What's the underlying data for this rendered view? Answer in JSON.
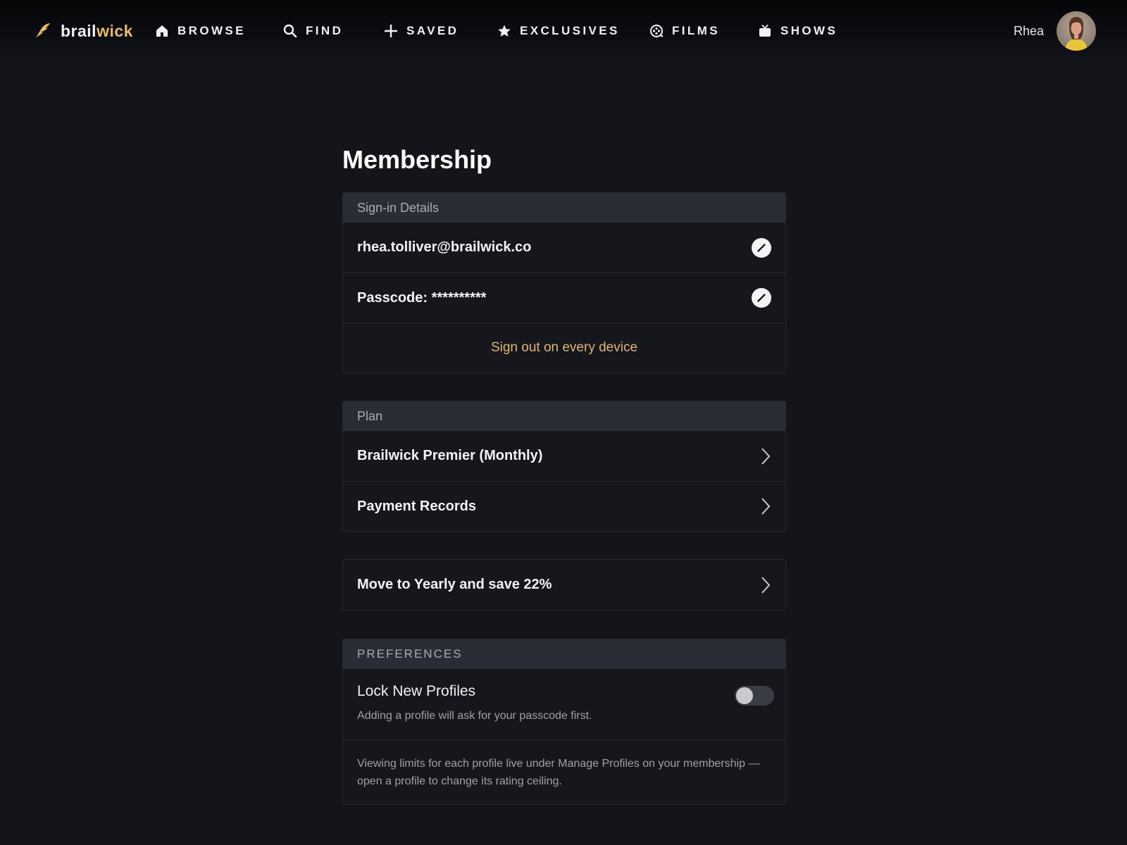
{
  "brand": {
    "name_part1": "brail",
    "name_part2": "wick",
    "accent": "#e8b96a"
  },
  "nav": [
    {
      "label": "BROWSE",
      "icon": "home-icon"
    },
    {
      "label": "FIND",
      "icon": "search-icon"
    },
    {
      "label": "SAVED",
      "icon": "plus-icon"
    },
    {
      "label": "EXCLUSIVES",
      "icon": "star-icon"
    },
    {
      "label": "FILMS",
      "icon": "film-icon"
    },
    {
      "label": "SHOWS",
      "icon": "tv-icon"
    }
  ],
  "user": {
    "name": "Rhea"
  },
  "page": {
    "title": "Membership"
  },
  "signin": {
    "header": "Sign-in Details",
    "email": "rhea.tolliver@brailwick.co",
    "passcode": "Passcode: **********",
    "sign_out": "Sign out on every device"
  },
  "plan": {
    "header": "Plan",
    "current_plan": "Brailwick Premier (Monthly)",
    "payment_records": "Payment Records"
  },
  "upgrade": {
    "label": "Move to Yearly and save 22%"
  },
  "preferences": {
    "header": "PREFERENCES",
    "lock_title": "Lock New Profiles",
    "lock_subtitle": "Adding a profile will ask for your passcode first.",
    "lock_enabled": false,
    "note": "Viewing limits for each profile live under Manage Profiles on your membership — open a profile to change its rating ceiling."
  }
}
